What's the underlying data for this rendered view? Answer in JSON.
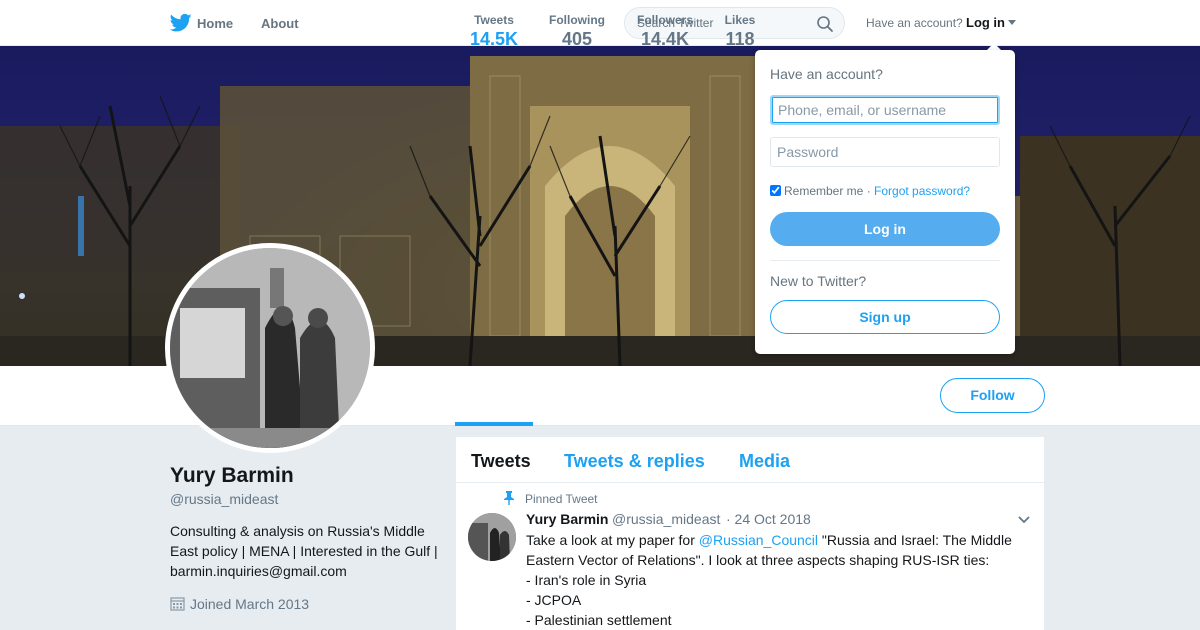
{
  "nav": {
    "home": "Home",
    "about": "About",
    "search_placeholder": "Search Twitter",
    "have_account": "Have an account?",
    "login": "Log in",
    "brand_color": "#1da1f2"
  },
  "profile": {
    "name": "Yury Barmin",
    "handle": "@russia_mideast",
    "bio": "Consulting & analysis on Russia's Middle East policy | MENA | Interested in the Gulf | barmin.inquiries@gmail.com",
    "joined": "Joined March 2013",
    "follow": "Follow"
  },
  "stats": [
    {
      "label": "Tweets",
      "value": "14.5K"
    },
    {
      "label": "Following",
      "value": "405"
    },
    {
      "label": "Followers",
      "value": "14.4K"
    },
    {
      "label": "Likes",
      "value": "118"
    }
  ],
  "timeline": {
    "tabs": [
      "Tweets",
      "Tweets & replies",
      "Media"
    ],
    "tweet": {
      "pinned": "Pinned Tweet",
      "name": "Yury Barmin",
      "handle": "@russia_mideast",
      "date": "· 24 Oct 2018",
      "text_before": "Take a look at my paper for ",
      "mention": "@Russian_Council",
      "text_after": " \"Russia and Israel: The Middle Eastern Vector of Relations\". I look at three aspects shaping RUS-ISR ties:",
      "lines": [
        "- Iran's role in Syria",
        "- JCPOA",
        "- Palestinian settlement"
      ]
    }
  },
  "login_dropdown": {
    "title": "Have an account?",
    "username_placeholder": "Phone, email, or username",
    "password_placeholder": "Password",
    "remember": "Remember me",
    "separator": " · ",
    "forgot": "Forgot password?",
    "login_button": "Log in",
    "new_to": "New to Twitter?",
    "signup": "Sign up"
  }
}
